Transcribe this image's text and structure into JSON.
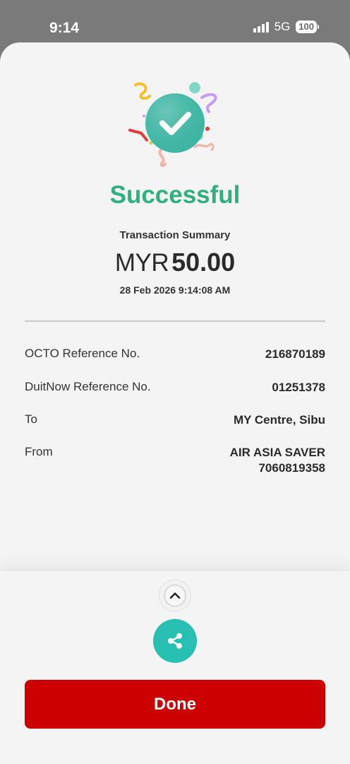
{
  "status_bar": {
    "time": "9:14",
    "network": "5G",
    "battery": "100"
  },
  "receipt": {
    "status_title": "Successful",
    "summary_label": "Transaction Summary",
    "currency": "MYR",
    "amount": "50.00",
    "datetime": "28 Feb 2026 9:14:08 AM",
    "details": [
      {
        "label": "OCTO Reference No.",
        "value": "216870189"
      },
      {
        "label": "DuitNow Reference No.",
        "value": "01251378"
      },
      {
        "label": "To",
        "value": "MY Centre, Sibu"
      },
      {
        "label": "From",
        "value": "AIR ASIA SAVER",
        "value2": "7060819358"
      }
    ]
  },
  "actions": {
    "collapse_icon": "chevron-up-icon",
    "share_icon": "share-icon",
    "done_label": "Done"
  },
  "colors": {
    "success_green": "#2fb07f",
    "share_teal": "#28c0b3",
    "done_red": "#cc0000"
  }
}
